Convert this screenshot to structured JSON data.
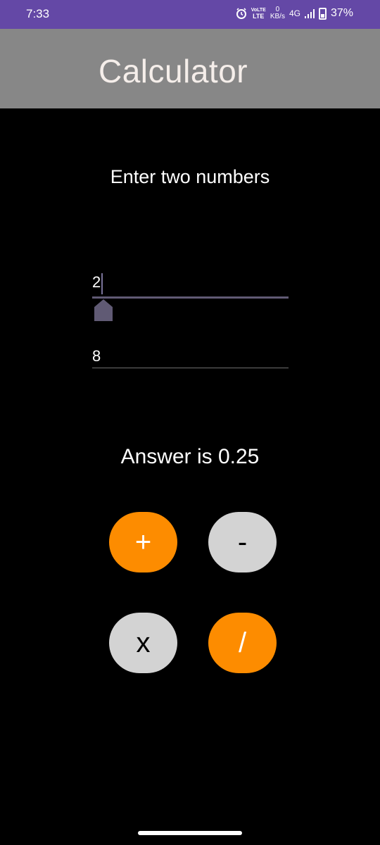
{
  "status": {
    "time": "7:33",
    "volte_top": "VoLTE",
    "volte_bottom": "LTE",
    "speed_value": "0",
    "speed_unit": "KB/s",
    "network": "4G",
    "battery": "37%"
  },
  "appbar": {
    "title": "Calculator"
  },
  "main": {
    "prompt": "Enter two numbers",
    "input1": {
      "value": "2"
    },
    "input2": {
      "value": "8"
    },
    "answer": "Answer is 0.25"
  },
  "buttons": {
    "add": "+",
    "subtract": "-",
    "multiply": "x",
    "divide": "/"
  },
  "colors": {
    "status_bar": "#6448a6",
    "app_bar": "#878787",
    "accent_orange": "#fd8c00",
    "grey_button": "#d3d3d3"
  }
}
